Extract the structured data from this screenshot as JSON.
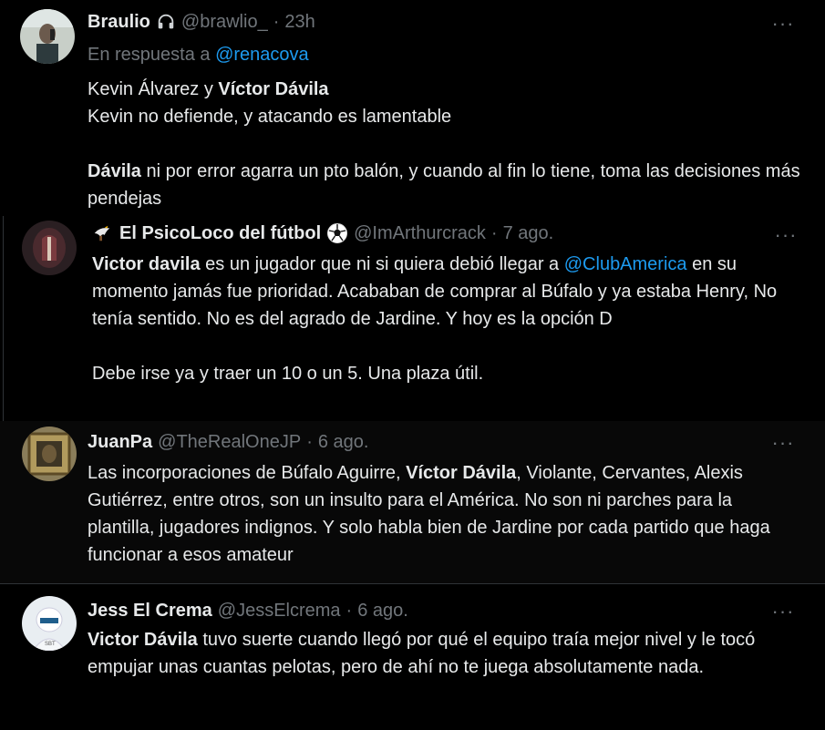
{
  "tweets": [
    {
      "name": "Braulio",
      "handle": "@brawlio_",
      "time": "23h",
      "reply_prefix": "En respuesta a",
      "reply_to": "@renacova",
      "line1_a": "Kevin Álvarez y ",
      "line1_b": "Víctor Dávila",
      "line2": "Kevin no defiende, y atacando es lamentable",
      "line3_a": "Dávila",
      "line3_b": " ni por error agarra un pto balón, y cuando al fin lo tiene, toma las decisiones más pendejas",
      "icon": "headphones-icon"
    },
    {
      "name": "El PsicoLoco del fútbol",
      "handle": "@ImArthurcrack",
      "time": "7 ago.",
      "p1_a": "Victor davila",
      "p1_b": " es un jugador que ni si quiera debió llegar a ",
      "p1_mention": "@ClubAmerica",
      "p1_c": " en su momento jamás fue prioridad. Acababan de comprar al Búfalo y ya estaba Henry, No tenía sentido. No es del agrado de Jardine. Y hoy es la opción D",
      "p2": "Debe irse ya y traer un 10 o un 5. Una plaza útil.",
      "icons": [
        "eagle-icon",
        "soccer-ball-icon"
      ]
    },
    {
      "name": "JuanPa",
      "handle": "@TheRealOneJP",
      "time": "6 ago.",
      "p1_a": "Las incorporaciones de Búfalo Aguirre, ",
      "p1_b": "Víctor Dávila",
      "p1_c": ", Violante, Cervantes, Alexis Gutiérrez, entre otros, son un insulto para el América. No son ni parches para la plantilla, jugadores indignos. Y solo habla bien de Jardine por cada partido que haga funcionar a esos amateur"
    },
    {
      "name": "Jess El Crema",
      "handle": "@JessElcrema",
      "time": "6 ago.",
      "p1_a": "Victor Dávila",
      "p1_b": " tuvo suerte  cuando llegó por qué el equipo traía mejor nivel y le tocó empujar unas cuantas pelotas, pero de ahí no te juega absolutamente nada."
    }
  ],
  "separator": "·",
  "more_label": "···"
}
